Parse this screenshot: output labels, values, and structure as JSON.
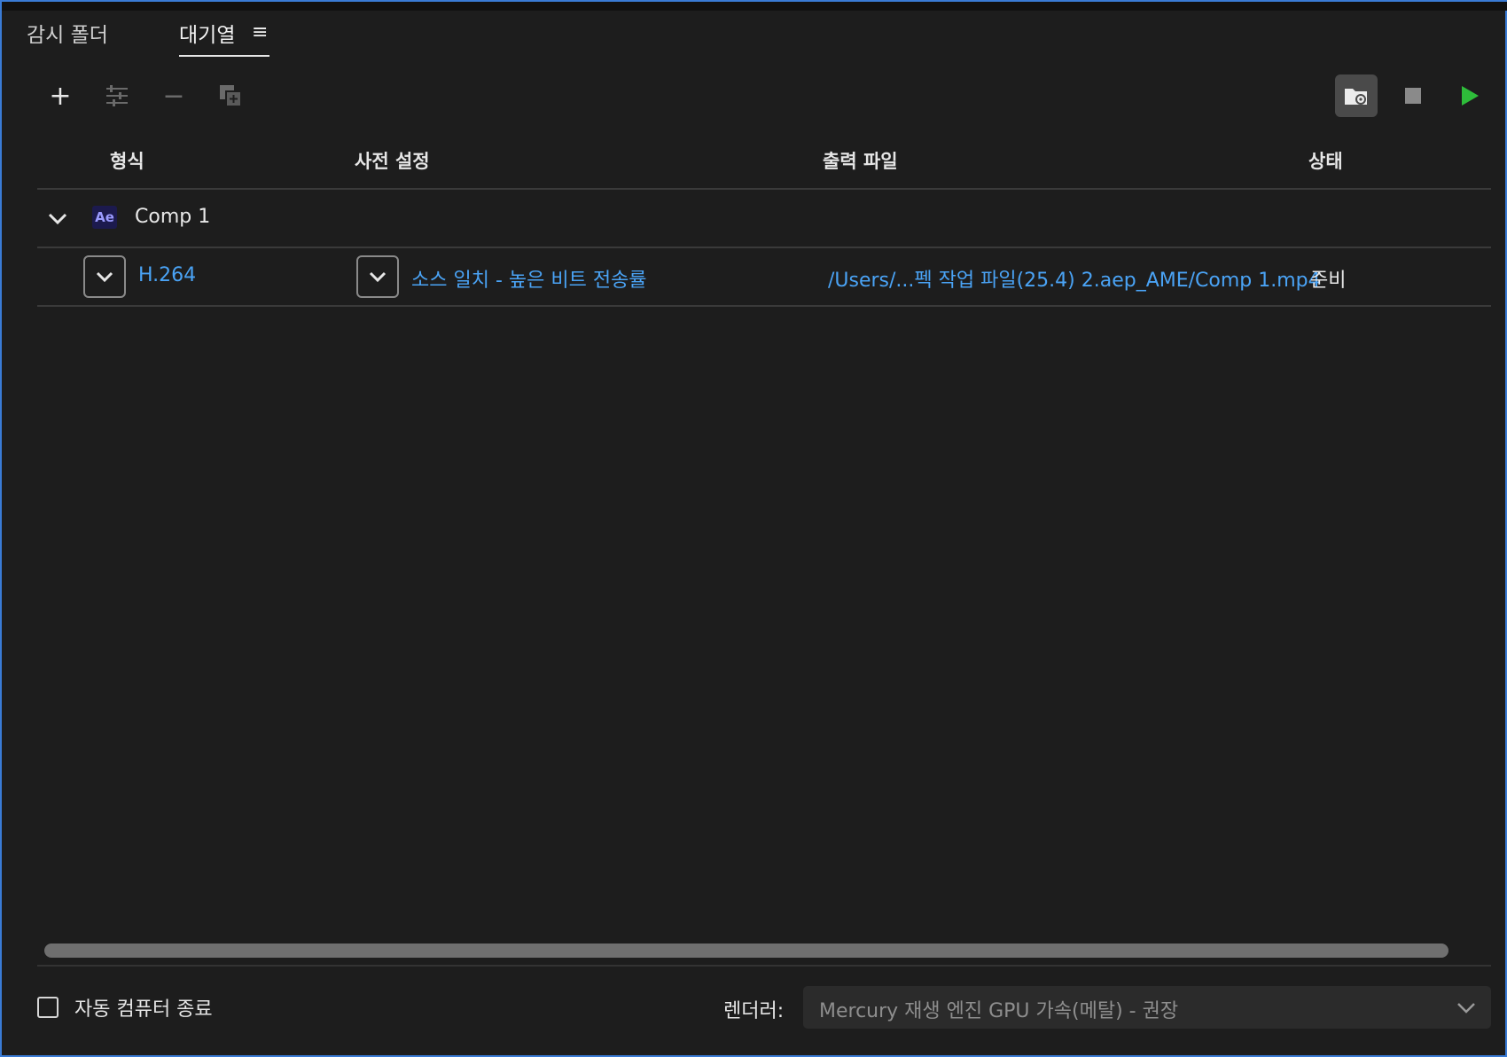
{
  "tabs": {
    "watch_folders": "감시 폴더",
    "queue": "대기열",
    "queue_menu_icon": "hamburger-menu-icon"
  },
  "toolbar": {
    "add_icon": "plus-icon",
    "settings_icon": "sliders-icon",
    "remove_icon": "minus-icon",
    "duplicate_icon": "duplicate-icon",
    "watch_icon": "folder-gear-icon",
    "stop_icon": "stop-icon",
    "play_icon": "play-icon",
    "play_color": "#2ebd3a"
  },
  "table": {
    "headers": {
      "format": "형식",
      "preset": "사전 설정",
      "output": "출력 파일",
      "status": "상태"
    },
    "group": {
      "app_badge": "Ae",
      "name": "Comp 1"
    },
    "row": {
      "format": "H.264",
      "preset": "소스 일치 - 높은 비트 전송률",
      "output": "/Users/...펙 작업 파일(25.4) 2.aep_AME/Comp 1.mp4",
      "status": "준비"
    }
  },
  "footer": {
    "auto_shutdown_label": "자동 컴퓨터 종료",
    "auto_shutdown_checked": false,
    "renderer_label": "렌더러:",
    "renderer_value": "Mercury 재생 엔진 GPU 가속(메탈) - 권장"
  },
  "colors": {
    "link": "#4aa3f5",
    "accent_border": "#3a7bd5",
    "background": "#1d1d1d"
  }
}
